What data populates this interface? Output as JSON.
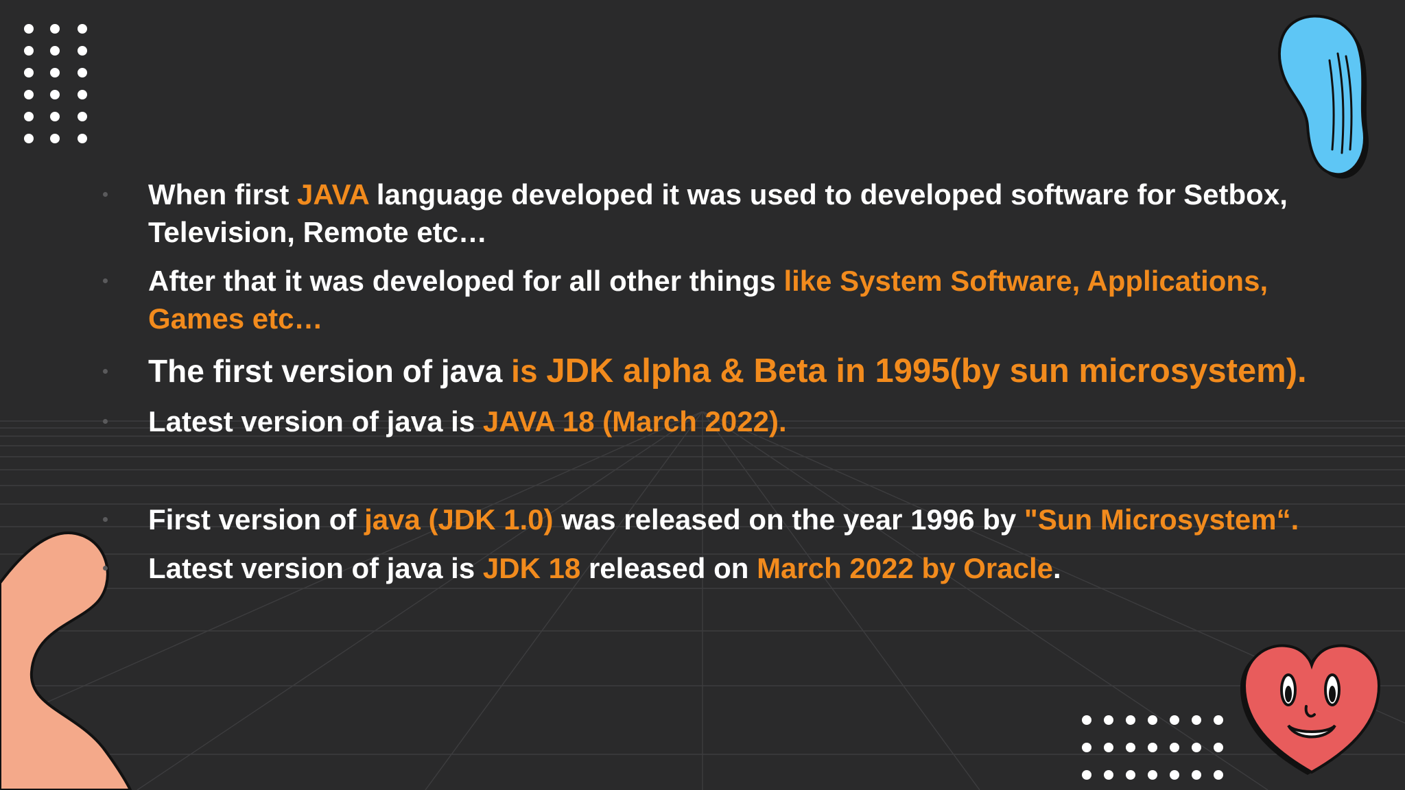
{
  "slide": {
    "background": "#2a2a2b",
    "accent_color": "#f28b1d",
    "bullets": [
      {
        "parts": [
          {
            "text": "When first ",
            "highlight": false
          },
          {
            "text": "JAVA",
            "highlight": true
          },
          {
            "text": " language developed it was used to developed software for Setbox, Television, Remote etc…",
            "highlight": false
          }
        ]
      },
      {
        "parts": [
          {
            "text": "After that it was developed for all other things ",
            "highlight": false
          },
          {
            "text": "like System Software, Applications, Games etc…",
            "highlight": true
          }
        ]
      },
      {
        "parts": [
          {
            "text": "The first version of java ",
            "highlight": false
          },
          {
            "text": "is ",
            "highlight": true
          },
          {
            "text": "JDK alpha & Beta in 1995(by sun microsystem).",
            "highlight": true
          }
        ]
      },
      {
        "parts": [
          {
            "text": "Latest version of java is ",
            "highlight": false
          },
          {
            "text": "JAVA 18 (March 2022).",
            "highlight": true
          }
        ]
      },
      {
        "parts": [
          {
            "text": "First version of ",
            "highlight": false
          },
          {
            "text": "java (JDK 1.0)",
            "highlight": true
          },
          {
            "text": " was released on the year 1996 by ",
            "highlight": false
          },
          {
            "text": "\"Sun Microsystem“.",
            "highlight": true
          }
        ]
      },
      {
        "parts": [
          {
            "text": "Latest version of java is ",
            "highlight": false
          },
          {
            "text": "JDK 18",
            "highlight": true
          },
          {
            "text": " released on ",
            "highlight": false
          },
          {
            "text": "March 2022 by Oracle",
            "highlight": true
          },
          {
            "text": ".",
            "highlight": false
          }
        ]
      }
    ],
    "decorations": {
      "dot_grid_top_left": {
        "icon": "dot-grid-icon",
        "color": "#ffffff"
      },
      "dot_grid_bottom_right": {
        "icon": "dot-grid-icon",
        "color": "#ffffff"
      },
      "blue_blob": {
        "icon": "blue-blob-icon",
        "color": "#5ec6f5"
      },
      "peach_blob": {
        "icon": "peach-blob-icon",
        "color": "#f4a98a"
      },
      "heart_face": {
        "icon": "heart-face-icon",
        "color": "#e85c5c"
      }
    }
  }
}
